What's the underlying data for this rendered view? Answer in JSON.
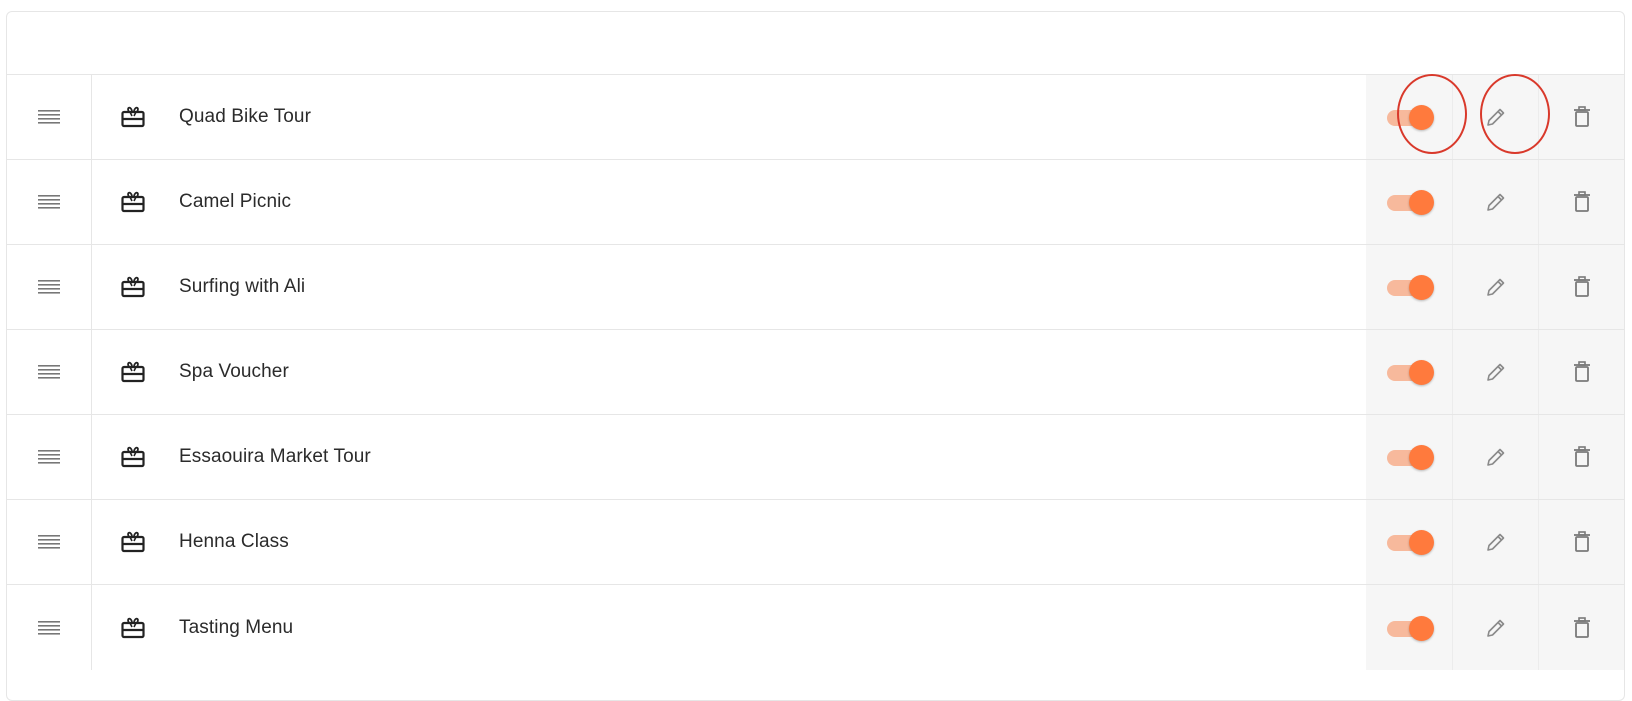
{
  "rows": [
    {
      "name": "Quad Bike Tour",
      "enabled": true
    },
    {
      "name": "Camel Picnic",
      "enabled": true
    },
    {
      "name": "Surfing with Ali",
      "enabled": true
    },
    {
      "name": "Spa Voucher",
      "enabled": true
    },
    {
      "name": "Essaouira Market Tour",
      "enabled": true
    },
    {
      "name": "Henna Class",
      "enabled": true
    },
    {
      "name": "Tasting Menu",
      "enabled": true
    }
  ],
  "icons": {
    "drag": "drag-handle-icon",
    "item": "gift-card-icon",
    "edit": "pencil-icon",
    "delete": "trash-icon"
  },
  "colors": {
    "accent": "#ff7a3d",
    "accent_light": "#f7b99c",
    "highlight": "#d9392b"
  }
}
